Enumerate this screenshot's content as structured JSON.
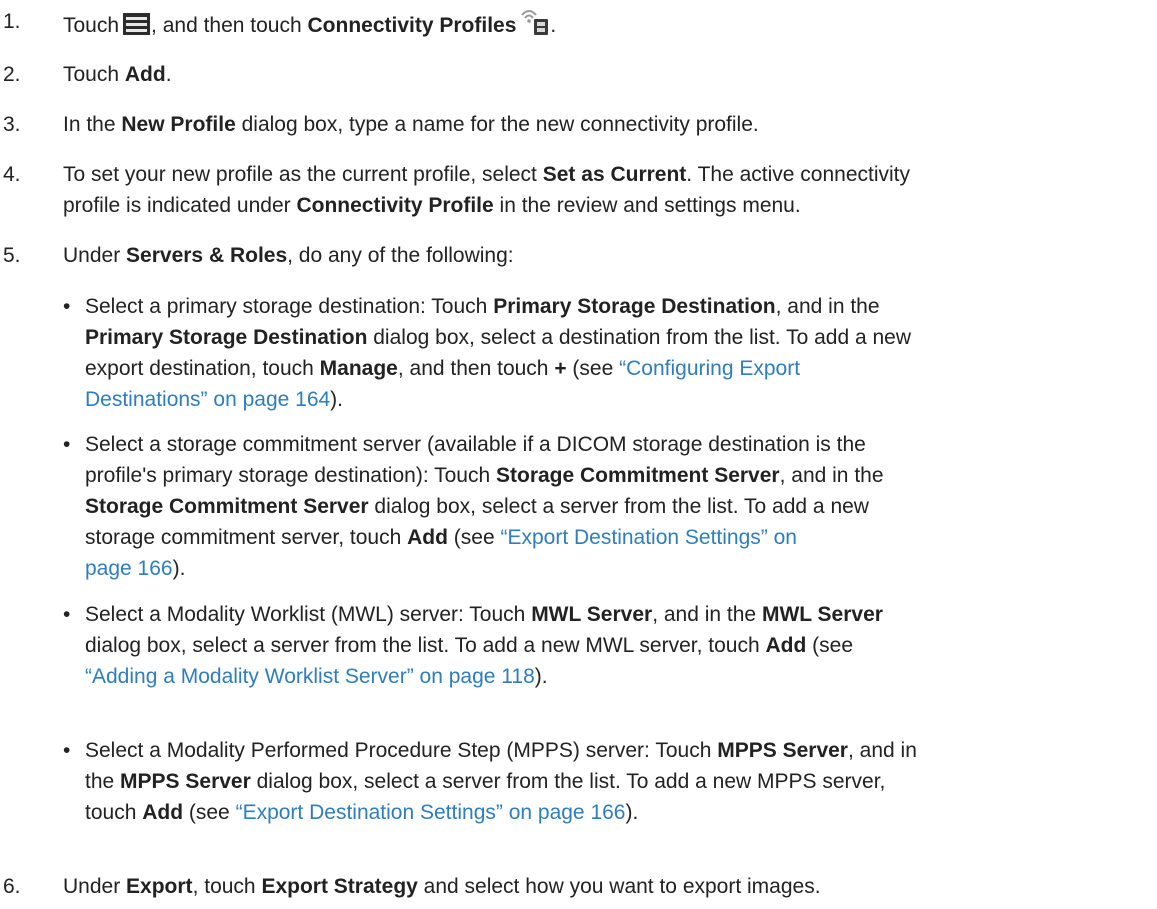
{
  "steps": [
    {
      "num": "1.",
      "p1": "Touch",
      "p2": ", and then touch",
      "b1": "Connectivity Profiles",
      "p3": "."
    },
    {
      "num": "2.",
      "p1": "Touch",
      "b1": "Add",
      "p2": "."
    },
    {
      "num": "3.",
      "p1": "In the",
      "b1": "New Profile",
      "p2": " dialog box, type a name for the new connectivity profile."
    },
    {
      "num": "4.",
      "p1": "To set your new profile as the current profile, select",
      "b1": "Set as Current",
      "p2": ". The active connectivity",
      "p3": "profile is indicated under",
      "b2": "Connectivity Profile",
      "p4": " in the review and settings menu."
    },
    {
      "num": "5.",
      "p1": "Under",
      "b1": "Servers & Roles",
      "p2": ", do any of the following:"
    },
    {
      "num": "6.",
      "p1": "Under",
      "b1": "Export",
      "p2": ", touch",
      "b2": "Export Strategy",
      "p3": " and select how you want to export images."
    }
  ],
  "bullets": [
    {
      "dot": "•",
      "t1": "Select a primary storage destination: Touch",
      "b1": "Primary Storage Destination",
      "t2": ", and in the",
      "b2": "Primary Storage Destination",
      "t3": " dialog box, select a destination from the list. To add a new",
      "t4": "export destination, touch",
      "b3": "Manage",
      "t5": ", and then touch",
      "b4": "+",
      "t6": " (see",
      "l1": "“Configuring Export",
      "l2": "Destinations” on page 164",
      "t7": ")."
    },
    {
      "dot": "•",
      "t1": "Select a storage commitment server (available if a DICOM storage destination is the",
      "t2": "profile's primary storage destination): Touch",
      "b1": "Storage Commitment Server",
      "t3": ", and in the",
      "b2": "Storage Commitment Server",
      "t4": " dialog box, select a server from the list. To add a new",
      "t5": "storage commitment server, touch",
      "b3": "Add",
      "t6": " (see",
      "l1": "“Export Destination Settings” on",
      "l2": "page 166",
      "t7": ")."
    },
    {
      "dot": "•",
      "t1": "Select a Modality Worklist (MWL) server: Touch",
      "b1": "MWL Server",
      "t2": ", and in the",
      "b2": "MWL Server",
      "t3": "dialog box, select a server from the list. To add a new MWL server, touch",
      "b3": "Add",
      "t4": " (see",
      "l1": "“Adding a Modality Worklist Server” on page 118",
      "t5": ")."
    },
    {
      "dot": "•",
      "t1": "Select a Modality Performed Procedure Step (MPPS) server: Touch",
      "b1": "MPPS Server",
      "t2": ", and in",
      "t3": "the",
      "b2": "MPPS Server",
      "t4": " dialog box, select a server from the list. To add a new MPPS server,",
      "t5": "touch",
      "b3": "Add",
      "t6": " (see",
      "l1": "“Export Destination Settings” on page 166",
      "t7": ")."
    }
  ]
}
